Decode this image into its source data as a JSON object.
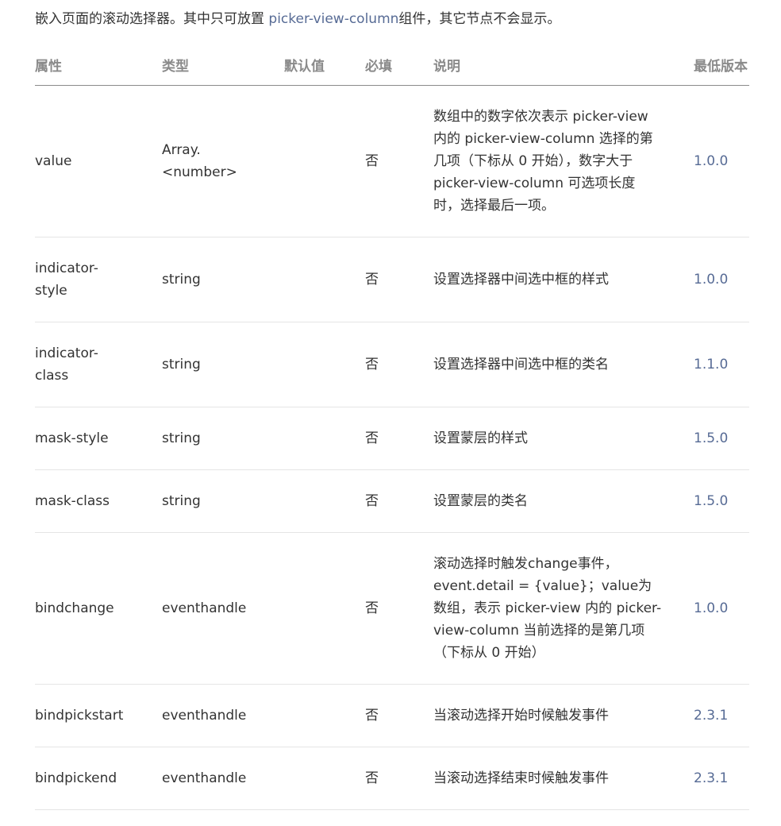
{
  "intro": {
    "before": "嵌入页面的滚动选择器。其中只可放置 ",
    "link": "picker-view-column",
    "after": "组件，其它节点不会显示。"
  },
  "table": {
    "headers": [
      "属性",
      "类型",
      "默认值",
      "必填",
      "说明",
      "最低版本"
    ],
    "rows": [
      {
        "attr": "value",
        "type": "Array.<number>",
        "default": "",
        "required": "否",
        "desc": "数组中的数字依次表示 picker-view 内的 picker-view-column 选择的第几项（下标从 0 开始），数字大于 picker-view-column 可选项长度时，选择最后一项。",
        "version": "1.0.0"
      },
      {
        "attr": "indicator-style",
        "type": "string",
        "default": "",
        "required": "否",
        "desc": "设置选择器中间选中框的样式",
        "version": "1.0.0"
      },
      {
        "attr": "indicator-class",
        "type": "string",
        "default": "",
        "required": "否",
        "desc": "设置选择器中间选中框的类名",
        "version": "1.1.0"
      },
      {
        "attr": "mask-style",
        "type": "string",
        "default": "",
        "required": "否",
        "desc": "设置蒙层的样式",
        "version": "1.5.0"
      },
      {
        "attr": "mask-class",
        "type": "string",
        "default": "",
        "required": "否",
        "desc": "设置蒙层的类名",
        "version": "1.5.0"
      },
      {
        "attr": "bindchange",
        "type": "eventhandle",
        "default": "",
        "required": "否",
        "desc": "滚动选择时触发change事件，event.detail = {value}；value为数组，表示 picker-view 内的 picker-view-column 当前选择的是第几项（下标从 0 开始）",
        "version": "1.0.0"
      },
      {
        "attr": "bindpickstart",
        "type": "eventhandle",
        "default": "",
        "required": "否",
        "desc": "当滚动选择开始时候触发事件",
        "version": "2.3.1"
      },
      {
        "attr": "bindpickend",
        "type": "eventhandle",
        "default": "",
        "required": "否",
        "desc": "当滚动选择结束时候触发事件",
        "version": "2.3.1"
      }
    ]
  }
}
